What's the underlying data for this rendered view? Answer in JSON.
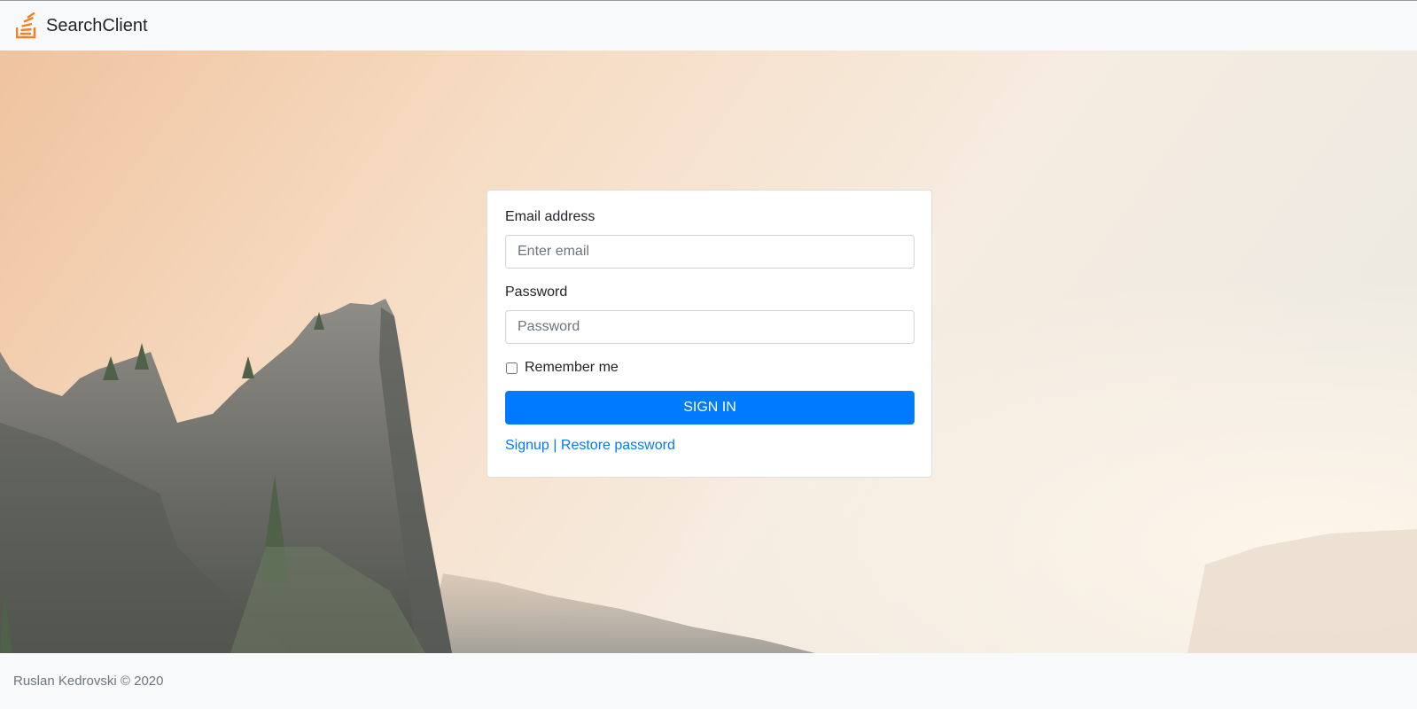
{
  "navbar": {
    "brand_name": "SearchClient",
    "brand_icon": "stack-icon",
    "brand_icon_color": "#f48024"
  },
  "login_form": {
    "email_label": "Email address",
    "email_placeholder": "Enter email",
    "email_value": "",
    "password_label": "Password",
    "password_placeholder": "Password",
    "password_value": "",
    "remember_label": "Remember me",
    "remember_checked": false,
    "submit_label": "SIGN IN",
    "signup_link": "Signup",
    "separator": "|",
    "restore_link": "Restore password"
  },
  "footer": {
    "copyright": "Ruslan Kedrovski © 2020"
  },
  "colors": {
    "primary": "#007bff",
    "navbar_bg": "#f8f9fa",
    "text_muted": "#6c757d"
  }
}
